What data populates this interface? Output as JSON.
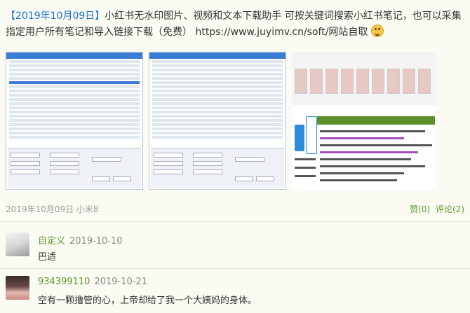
{
  "post": {
    "date": "【2019年10月09日】",
    "title": "小红书无水印图片、视频和文本下载助手 可按关键词搜索小红书笔记，也可以采集指定用户所有笔记和导入链接下载（免费）",
    "url": "https://www.juyimv.cn/soft/网站自取",
    "emoji_icon": "grinning-face-icon"
  },
  "meta": {
    "date": "2019年10月09日",
    "device": "小米8",
    "likes": "赞(0)",
    "comments": "评论(2)"
  },
  "comments": [
    {
      "user": "自定义",
      "date": "2019-10-10",
      "text": "巴适"
    },
    {
      "user": "934399110",
      "date": "2019-10-21",
      "text": "空有一颗撸管的心，上帝却给了我一个大姨妈的身体。"
    }
  ]
}
